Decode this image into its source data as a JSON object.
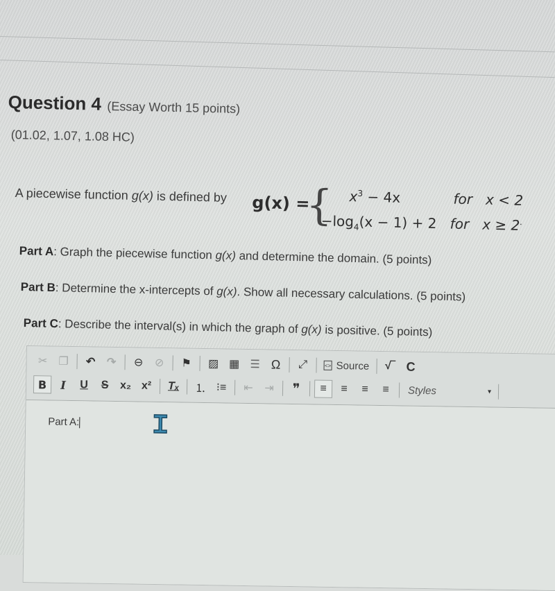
{
  "question": {
    "title": "Question 4",
    "worth": "(Essay Worth 15 points)",
    "codes": "(01.02, 1.07, 1.08 HC)"
  },
  "prompt": {
    "intro_before": "A piecewise function ",
    "intro_fn": "g(x)",
    "intro_after": " is defined by ",
    "formula": {
      "lhs": "g(x) =",
      "brace": "{",
      "piece1_expr_base": "x",
      "piece1_expr_exp": "3",
      "piece1_expr_rest": " − 4x",
      "piece1_for": "for",
      "piece1_cond": "x < 2",
      "piece2_expr_pre": "−log",
      "piece2_expr_sub": "4",
      "piece2_expr_rest": "(x − 1) + 2",
      "piece2_for": "for",
      "piece2_cond": "x ≥ 2",
      "terminal_punct": "."
    }
  },
  "parts": [
    {
      "label": "Part A",
      "text_before": ": Graph the piecewise function ",
      "fn": "g(x)",
      "text_after": " and determine the domain. (5 points)"
    },
    {
      "label": "Part B",
      "text_before": ": Determine the x-intercepts of ",
      "fn": "g(x)",
      "text_after": ". Show all necessary calculations. (5 points)"
    },
    {
      "label": "Part C",
      "text_before": ": Describe the interval(s) in which the graph of ",
      "fn": "g(x)",
      "text_after": " is positive. (5 points)"
    }
  ],
  "editor": {
    "toolbar_row1": {
      "cut": {
        "icon": "scissors-icon",
        "glyph": "✂",
        "enabled": false
      },
      "copy": {
        "icon": "copy-icon",
        "glyph": "❐",
        "enabled": false
      },
      "undo": {
        "icon": "undo-icon",
        "glyph": "↶",
        "enabled": true
      },
      "redo": {
        "icon": "redo-icon",
        "glyph": "↷",
        "enabled": false
      },
      "link": {
        "icon": "link-icon",
        "glyph": "⊖",
        "enabled": true
      },
      "unlink": {
        "icon": "unlink-icon",
        "glyph": "⊘",
        "enabled": false
      },
      "anchor": {
        "icon": "flag-icon",
        "glyph": "⚑",
        "enabled": true
      },
      "image": {
        "icon": "image-icon",
        "glyph": "▨",
        "enabled": true
      },
      "table": {
        "icon": "table-icon",
        "glyph": "▦",
        "enabled": true
      },
      "hline": {
        "icon": "horizontal-line-icon",
        "glyph": "☰",
        "enabled": true
      },
      "special_char": {
        "icon": "omega-icon",
        "glyph": "Ω",
        "enabled": true
      },
      "maximize": {
        "icon": "maximize-icon",
        "glyph": "⤢",
        "enabled": true
      },
      "source_label": "Source",
      "math": {
        "icon": "square-root-icon",
        "glyph": "√‾",
        "enabled": true
      },
      "chem": {
        "icon": "chemistry-c-icon",
        "glyph": "C",
        "enabled": true
      }
    },
    "toolbar_row2": {
      "bold": "B",
      "italic": "I",
      "underline": "U",
      "strike": "S",
      "subscript": "x₂",
      "superscript": "x²",
      "remove_format": "Tₓ",
      "numbered_list": {
        "icon": "numbered-list-icon",
        "glyph": "⒈"
      },
      "bulleted_list": {
        "icon": "bulleted-list-icon",
        "glyph": "⁝≡"
      },
      "outdent": {
        "icon": "outdent-icon",
        "glyph": "⇤"
      },
      "indent": {
        "icon": "indent-icon",
        "glyph": "⇥"
      },
      "blockquote": "❞",
      "align_left": "≡",
      "align_center": "≡",
      "align_right": "≡",
      "align_justify": "≡",
      "styles_label": "Styles",
      "styles_caret": "▾"
    },
    "content_text": "Part A:"
  }
}
